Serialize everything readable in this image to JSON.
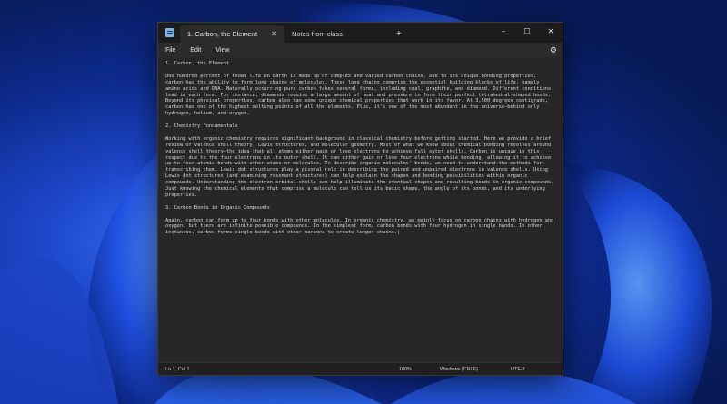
{
  "window": {
    "tabs": [
      {
        "label": "1. Carbon, the Element",
        "active": true
      },
      {
        "label": "Notes from class",
        "active": false
      }
    ],
    "new_tab": "+",
    "controls": {
      "minimize": "–",
      "maximize": "☐",
      "close": "✕"
    }
  },
  "menu": {
    "items": [
      "File",
      "Edit",
      "View"
    ],
    "settings_icon": "gear-icon"
  },
  "document": {
    "h1": "1. Carbon, the Element",
    "p1": "One hundred percent of known life on Earth is made up of complex and varied carbon chains. Due to its unique bonding properties, carbon has the ability to form long chains of molecules. These long chains comprise the essential building blocks of life, namely amino acids and DNA. Naturally occurring pure carbon takes several forms, including coal, graphite, and diamond. Different conditions lead to each form. For instance, diamonds require a large amount of heat and pressure to form their perfect tetrahedral-shaped bonds. Beyond its physical properties, carbon also has some unique chemical properties that work in its favor. At 3,500 degrees centigrade, carbon has one of the highest melting points of all the elements. Plus, it's one of the most abundant in the universe—behind only hydrogen, helium, and oxygen.",
    "h2": "2. Chemistry Fundamentals",
    "p2": "Working with organic chemistry requires significant background in classical chemistry before getting started. Here we provide a brief review of valence shell theory, Lewis structures, and molecular geometry. Most of what we know about chemical bonding revolves around valence shell theory—the idea that all atoms either gain or lose electrons to achieve full outer shells. Carbon is unique in this respect due to the four electrons in its outer shell. It can either gain or lose four electrons while bonding, allowing it to achieve up to four atomic bonds with other atoms or molecules. To describe organic molecules' bonds, we need to understand the methods for transcribing them. Lewis dot structures play a pivotal role in describing the paired and unpaired electrons in valence shells. Using Lewis dot structures (and examining resonant structures) can help explain the shapes and bonding possibilities within organic compounds. Understanding the electron orbital shells can help illuminate the eventual shapes and resulting bonds in organic compounds. Just knowing the chemical elements that comprise a molecule can tell us its basic shape, the angle of its bonds, and its underlying properties.",
    "h3": "3. Carbon Bonds in Organic Compounds",
    "p3": "Again, carbon can form up to four bonds with other molecules. In organic chemistry, we mainly focus on carbon chains with hydrogen and oxygen, but there are infinite possible compounds. In the simplest form, carbon bonds with four hydrogen in single bonds. In other instances, carbon forms single bonds with other carbons to create longer chains.|"
  },
  "status": {
    "position": "Ln 1, Col 1",
    "zoom": "100%",
    "line_ending": "Windows (CRLF)",
    "encoding": "UTF-8"
  }
}
